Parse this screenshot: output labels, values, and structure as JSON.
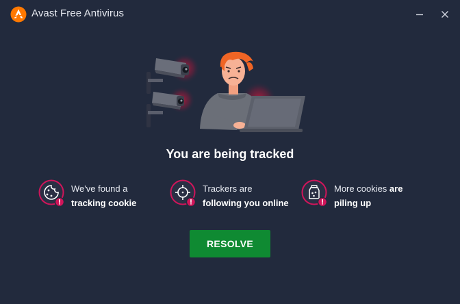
{
  "window": {
    "title": "Avast Free Antivirus",
    "brand_color": "#ff7800",
    "background": "#222a3d"
  },
  "titlebar_icons": {
    "logo": "avast-logo-icon",
    "minimize": "minimize-icon",
    "close": "close-icon"
  },
  "headline": "You are being tracked",
  "features": [
    {
      "icon": "cookie-icon",
      "line1_regular": "We've found a",
      "line2_bold": "tracking cookie"
    },
    {
      "icon": "crosshair-icon",
      "line1_regular": "Trackers are",
      "line2_bold": "following you online"
    },
    {
      "icon": "cookie-jar-icon",
      "line1_regular": "More cookies ",
      "line1_bold": "are",
      "line2_bold": "piling up"
    }
  ],
  "alert_badge_color": "#d0155a",
  "resolve_button": {
    "label": "RESOLVE",
    "color": "#0f8a32"
  }
}
